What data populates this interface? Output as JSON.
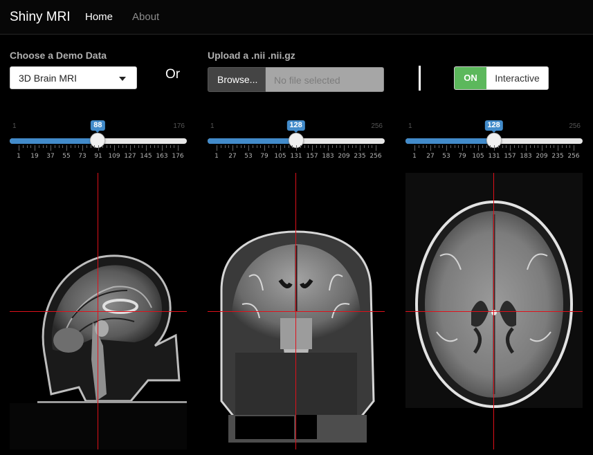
{
  "app": {
    "title": "Shiny MRI",
    "nav": [
      "Home",
      "About"
    ],
    "active_nav": "Home"
  },
  "controls": {
    "demo_label": "Choose a Demo Data",
    "demo_selected": "3D Brain MRI",
    "or_text": "Or",
    "upload_label": "Upload a .nii .nii.gz",
    "browse_label": "Browse...",
    "file_placeholder": "No file selected",
    "toggle_on": "ON",
    "toggle_label": "Interactive"
  },
  "sliders": [
    {
      "name": "sagittal",
      "min": 1,
      "max": 176,
      "value": 88,
      "labels": [
        "1",
        "19",
        "37",
        "55",
        "73",
        "91",
        "109",
        "127",
        "145",
        "163",
        "176"
      ]
    },
    {
      "name": "coronal",
      "min": 1,
      "max": 256,
      "value": 128,
      "labels": [
        "1",
        "27",
        "53",
        "79",
        "105",
        "131",
        "157",
        "183",
        "209",
        "235",
        "256"
      ]
    },
    {
      "name": "axial",
      "min": 1,
      "max": 256,
      "value": 128,
      "labels": [
        "1",
        "27",
        "53",
        "79",
        "105",
        "131",
        "157",
        "183",
        "209",
        "235",
        "256"
      ]
    }
  ],
  "views": [
    "sagittal-mri-slice",
    "coronal-mri-slice",
    "axial-mri-slice"
  ],
  "colors": {
    "accent": "#428bca",
    "toggle_on": "#5cb85c",
    "crosshair": "#e0101a"
  }
}
